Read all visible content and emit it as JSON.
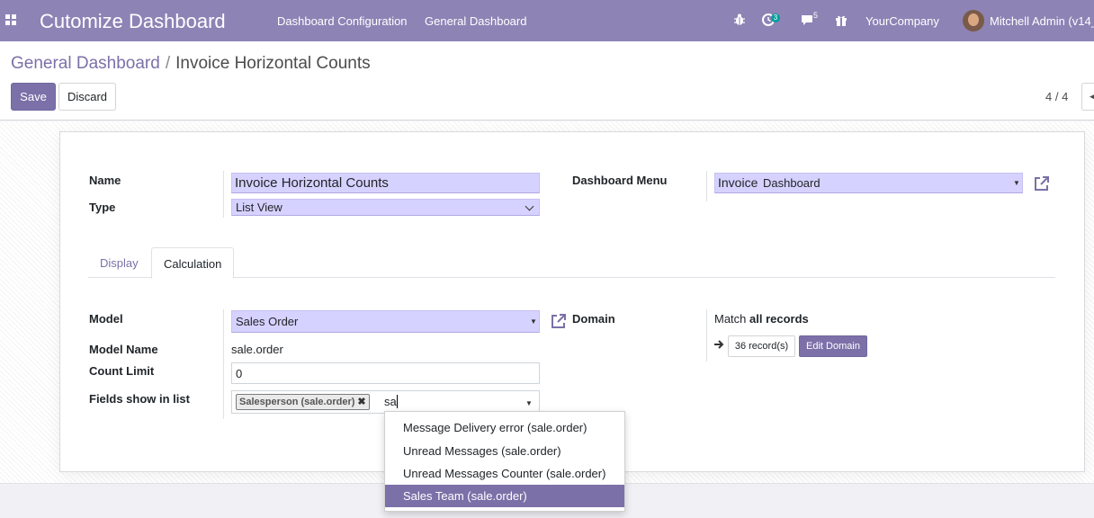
{
  "navbar": {
    "brand": "Cutomize Dashboard",
    "menu_items": [
      "Dashboard Configuration",
      "General Dashboard"
    ],
    "activity_count": "3",
    "message_count": "5",
    "company": "YourCompany",
    "user": "Mitchell Admin (v14_",
    "icons": [
      "apps-icon",
      "bug-icon",
      "activity-icon",
      "chat-icon",
      "gift-icon"
    ]
  },
  "breadcrumb": {
    "parent": "General Dashboard",
    "separator": "/",
    "current": "Invoice Horizontal Counts"
  },
  "actions": {
    "save": "Save",
    "discard": "Discard"
  },
  "pager": {
    "value": "4 / 4"
  },
  "form": {
    "name_label": "Name",
    "name_value": "Invoice Horizontal Counts",
    "type_label": "Type",
    "type_value": "List View",
    "menu_label": "Dashboard Menu",
    "menu_value_a": "Invoice",
    "menu_value_b": "Dashboard"
  },
  "tabs": [
    "Display",
    "Calculation"
  ],
  "active_tab": "Calculation",
  "calc": {
    "model_label": "Model",
    "model_value": "Sales Order",
    "model_name_label": "Model Name",
    "model_name_value": "sale.order",
    "count_limit_label": "Count Limit",
    "count_limit_value": "0",
    "fields_label": "Fields show in list",
    "fields_tag": "Salesperson (sale.order)",
    "fields_typed": "sa",
    "domain_label": "Domain",
    "domain_match_prefix": "Match",
    "domain_match_bold": "all records",
    "records_btn": "36 record(s)",
    "edit_domain": "Edit Domain"
  },
  "dropdown": {
    "items": [
      "Message Delivery error (sale.order)",
      "Unread Messages (sale.order)",
      "Unread Messages Counter (sale.order)",
      "Sales Team (sale.order)"
    ],
    "highlighted_index": 3
  },
  "colors": {
    "navbar": "#8d83b5",
    "accent": "#7c70a8",
    "required_field": "#d6d2ff",
    "badge": "#00a09d"
  }
}
